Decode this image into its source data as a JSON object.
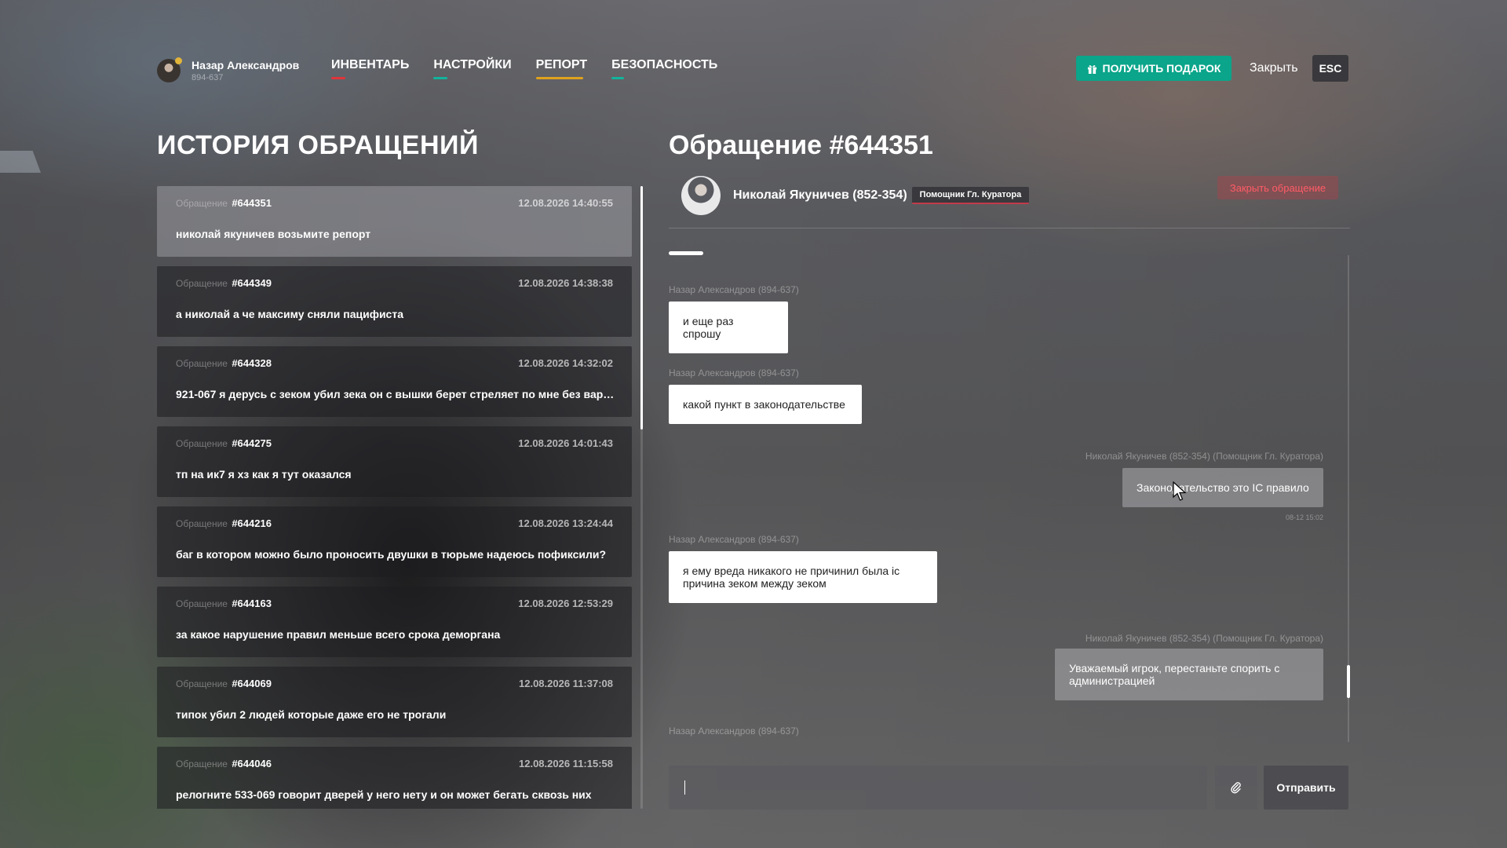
{
  "profile": {
    "name": "Назар Александров",
    "id": "894-637"
  },
  "nav": [
    {
      "label": "ИНВЕНТАРЬ",
      "color": "#e0343a",
      "uw": 18
    },
    {
      "label": "НАСТРОЙКИ",
      "color": "#12b49c",
      "uw": 18
    },
    {
      "label": "РЕПОРТ",
      "color": "#e0a21c",
      "uw": 60
    },
    {
      "label": "БЕЗОПАСНОСТЬ",
      "color": "#12b49c",
      "uw": 16
    }
  ],
  "header": {
    "gift_label": "ПОЛУЧИТЬ ПОДАРОК",
    "close_label": "Закрыть",
    "esc_label": "ESC"
  },
  "history": {
    "title": "ИСТОРИЯ ОБРАЩЕНИЙ",
    "label_prefix": "Обращение",
    "tickets": [
      {
        "num": "#644351",
        "date": "12.08.2026 14:40:55",
        "msg": "николай якуничев возьмите репорт",
        "active": true
      },
      {
        "num": "#644349",
        "date": "12.08.2026 14:38:38",
        "msg": "а николай а че максиму сняли пацифиста"
      },
      {
        "num": "#644328",
        "date": "12.08.2026 14:32:02",
        "msg": "921-067 я дерусь с зеком убил зека он с вышки берет стреляет по мне без варна"
      },
      {
        "num": "#644275",
        "date": "12.08.2026 14:01:43",
        "msg": "тп на ик7 я хз как я тут оказался"
      },
      {
        "num": "#644216",
        "date": "12.08.2026 13:24:44",
        "msg": "баг в котором можно было проносить двушки в тюрьме надеюсь пофиксили?"
      },
      {
        "num": "#644163",
        "date": "12.08.2026 12:53:29",
        "msg": "за какое нарушение правил меньше всего срока деморгана"
      },
      {
        "num": "#644069",
        "date": "12.08.2026 11:37:08",
        "msg": "типок убил 2 людей которые даже его не трогали"
      },
      {
        "num": "#644046",
        "date": "12.08.2026 11:15:58",
        "msg": "релогните 533-069 говорит дверей у него нету и он может бегать сквозь них"
      }
    ]
  },
  "ticket": {
    "title": "Обращение #644351",
    "agent_name": "Николай Якуничев (852-354)",
    "agent_role": "Помощник Гл. Куратора",
    "close_label": "Закрыть обращение"
  },
  "chat": {
    "messages": [
      {
        "author": "Назар Александров (894-637)",
        "text": "и еще раз спрошу",
        "side": "user"
      },
      {
        "author": "Назар Александров (894-637)",
        "text": "какой пункт в законодательстве",
        "side": "user"
      },
      {
        "author": "Николай Якуничев (852-354) (Помощник Гл. Куратора)",
        "text": "Законодательство это IC правило",
        "side": "admin",
        "time": "08-12 15:02"
      },
      {
        "author": "Назар Александров (894-637)",
        "text": "я ему вреда никакого не причинил была ic причина зеком между зеком",
        "side": "user"
      },
      {
        "author": "Николай Якуничев (852-354) (Помощник Гл. Куратора)",
        "text": "Уважаемый игрок, перестаньте спорить с администрацией",
        "side": "admin"
      },
      {
        "author": "Назар Александров (894-637)",
        "text": "",
        "side": "user"
      }
    ]
  },
  "composer": {
    "input_value": "",
    "placeholder": "",
    "send_label": "Отправить"
  }
}
